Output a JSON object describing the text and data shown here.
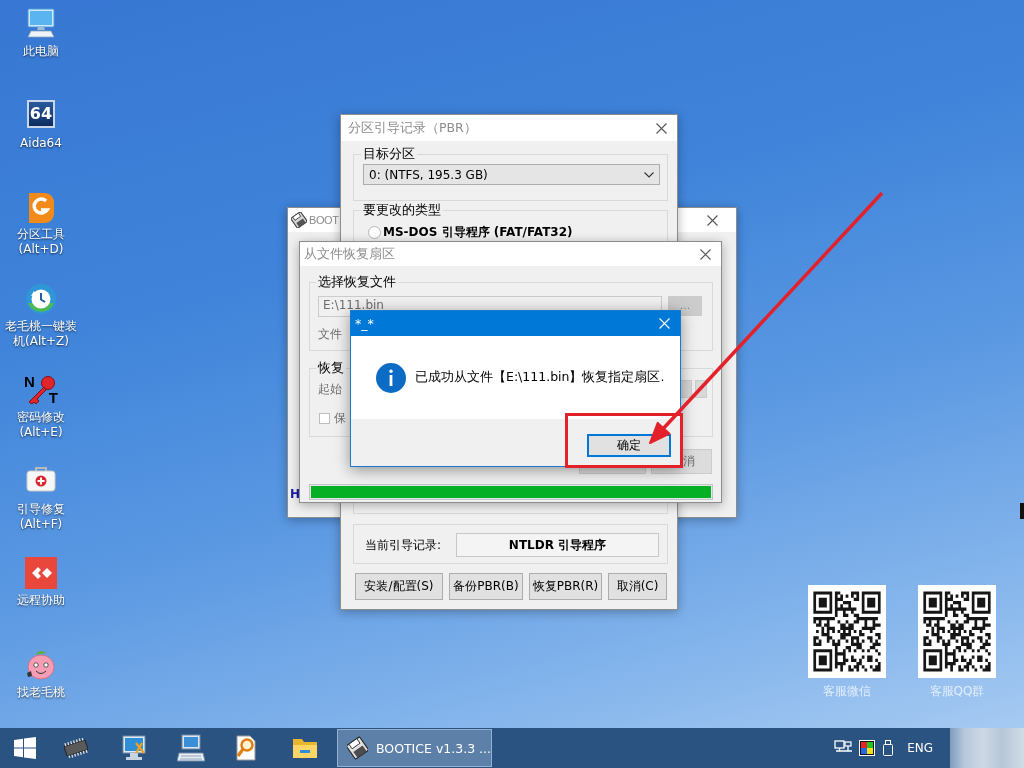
{
  "desktop": {
    "icons": [
      {
        "kind": "computer",
        "label": "此电脑"
      },
      {
        "kind": "aida",
        "label": "Aida64",
        "logo_text": "64"
      },
      {
        "kind": "partition",
        "label": "分区工具(Alt+D)"
      },
      {
        "kind": "installer",
        "label": "老毛桃一键装机(Alt+Z)"
      },
      {
        "kind": "password",
        "label": "密码修改(Alt+E)",
        "logo_letters": [
          "N",
          "T"
        ]
      },
      {
        "kind": "repair",
        "label": "引导修复(Alt+F)"
      },
      {
        "kind": "remote",
        "label": "远程协助"
      },
      {
        "kind": "mascot",
        "label": "找老毛桃"
      }
    ],
    "qr_codes": [
      {
        "label": "客服微信"
      },
      {
        "label": "客服QQ群"
      }
    ]
  },
  "bootice_window": {
    "title": "BOOT",
    "active": false,
    "text_fragment": "H"
  },
  "pbr_dialog": {
    "title": "分区引导记录（PBR）",
    "active": false,
    "target_partition": {
      "label": "目标分区",
      "value": "0: (NTFS, 195.3 GB)"
    },
    "change_type": {
      "label": "要更改的类型",
      "options": [
        {
          "label": "MS-DOS 引导程序 (FAT/FAT32)",
          "selected": false
        }
      ]
    },
    "current_record": {
      "label": "当前引导记录:",
      "value": "NTLDR 引导程序"
    },
    "buttons": [
      "安装/配置(S)",
      "备份PBR(B)",
      "恢复PBR(R)",
      "取消(C)"
    ]
  },
  "restore_dialog": {
    "title": "从文件恢复扇区",
    "active": false,
    "file_group": {
      "label": "选择恢复文件",
      "path_field": {
        "value": "E:\\111.bin",
        "disabled": true
      },
      "browse_button": {
        "label": "...",
        "disabled": true
      },
      "size_label": "文件"
    },
    "position_group": {
      "label": "恢复",
      "start_label": "起始",
      "keep_checkbox": {
        "label": "保",
        "checked": false
      }
    },
    "button_2": "消",
    "progress": {
      "level": 1
    }
  },
  "message_box": {
    "title": "*_*",
    "active": true,
    "message": "已成功从文件【E:\\111.bin】恢复指定扇区.",
    "ok_button": {
      "label": "确定",
      "focused": true
    }
  },
  "taskbar": {
    "task": {
      "label": "BOOTICE v1.3.3 ...",
      "selected": true
    },
    "language": "ENG"
  }
}
